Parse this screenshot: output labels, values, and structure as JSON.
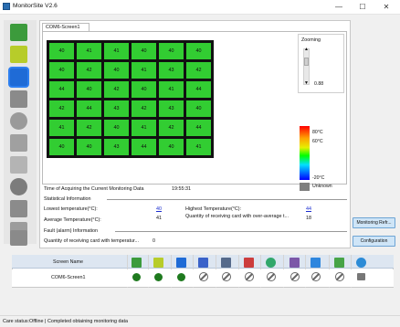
{
  "window": {
    "title": "MonitorSite V2.6",
    "minimize": "—",
    "maximize": "☐",
    "close": "✕"
  },
  "tab": {
    "label": "COM6-Screen1"
  },
  "grid": {
    "rows": [
      [
        "40",
        "41",
        "41",
        "40",
        "40",
        "40"
      ],
      [
        "40",
        "42",
        "40",
        "41",
        "43",
        "42"
      ],
      [
        "44",
        "40",
        "42",
        "40",
        "41",
        "44"
      ],
      [
        "42",
        "44",
        "43",
        "42",
        "43",
        "40"
      ],
      [
        "41",
        "42",
        "40",
        "41",
        "42",
        "44"
      ],
      [
        "40",
        "40",
        "43",
        "44",
        "40",
        "41"
      ]
    ]
  },
  "zoom": {
    "label": "Zooming",
    "value": "0.88",
    "up_arrow": "▲",
    "down_arrow": "▼"
  },
  "scale": {
    "high": "80°C",
    "mid": "60°C",
    "low": "-20°C",
    "unknown": "Unknown"
  },
  "info": {
    "acquire_label": "Time of Acquiring the Current Monitoring Data",
    "acquire_time": "19:55:31",
    "statistical_header": "Statistical Information",
    "lowest_label": "Lowest temperature(°C):",
    "lowest_value": "40",
    "highest_label": "Highest Temperature(°C):",
    "highest_value": "44",
    "average_label": "Average Temperature(°C):",
    "average_value": "41",
    "over_avg_label": "Quantity of receiving card with over-average t...",
    "over_avg_value": "18",
    "fault_header": "Fault (alarm) Information",
    "fault_label": "Quantity of receiving card with temperatur...",
    "fault_value": "0"
  },
  "side_buttons": {
    "monitoring": "Monitoring Refr...",
    "configuration": "Configuration"
  },
  "table": {
    "header_name": "Screen Name",
    "rows": [
      {
        "name": "COM6-Screen1"
      }
    ]
  },
  "status": {
    "text": "Care status:Offline | Completed obtaining monitoring data"
  },
  "colors": {
    "cell_green": "#32cd32",
    "status_dot": "#1f7a1f",
    "accent": "#2d7ff0"
  }
}
